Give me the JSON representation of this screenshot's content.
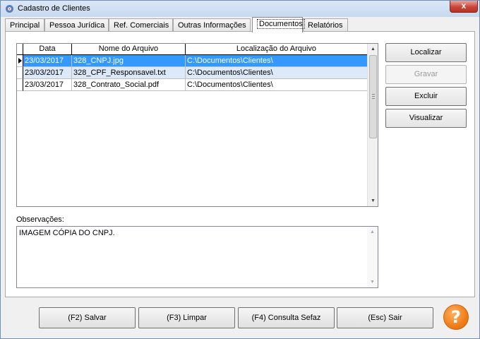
{
  "window": {
    "title": "Cadastro de Clientes",
    "close_label": "x",
    "icon": "app-gear-icon"
  },
  "tabs": [
    {
      "label": "Principal",
      "active": false
    },
    {
      "label": "Pessoa Jurídica",
      "active": false
    },
    {
      "label": "Ref. Comerciais",
      "active": false
    },
    {
      "label": "Outras Informações",
      "active": false
    },
    {
      "label": "Documentos",
      "active": true
    },
    {
      "label": "Relatórios",
      "active": false
    }
  ],
  "documents": {
    "columns": [
      "Data",
      "Nome do Arquivo",
      "Localização do Arquivo"
    ],
    "rows": [
      {
        "date": "23/03/2017",
        "name": "328_CNPJ.jpg",
        "location": "C:\\Documentos\\Clientes\\",
        "selected": true
      },
      {
        "date": "23/03/2017",
        "name": "328_CPF_Responsavel.txt",
        "location": "C:\\Documentos\\Clientes\\",
        "selected": false
      },
      {
        "date": "23/03/2017",
        "name": "328_Contrato_Social.pdf",
        "location": "C:\\Documentos\\Clientes\\",
        "selected": false
      }
    ]
  },
  "side_buttons": {
    "localizar": "Localizar",
    "gravar": "Gravar",
    "excluir": "Excluir",
    "visualizar": "Visualizar"
  },
  "observacoes": {
    "label": "Observações:",
    "value": "IMAGEM CÓPIA DO CNPJ."
  },
  "bottom_buttons": {
    "salvar": "(F2) Salvar",
    "limpar": "(F3) Limpar",
    "consulta": "(F4) Consulta Sefaz",
    "sair": "(Esc) Sair"
  },
  "help": {
    "label": "?"
  },
  "colors": {
    "selection": "#3399ff",
    "alt_row": "#dce9f8",
    "help_orange": "#f07d18"
  }
}
